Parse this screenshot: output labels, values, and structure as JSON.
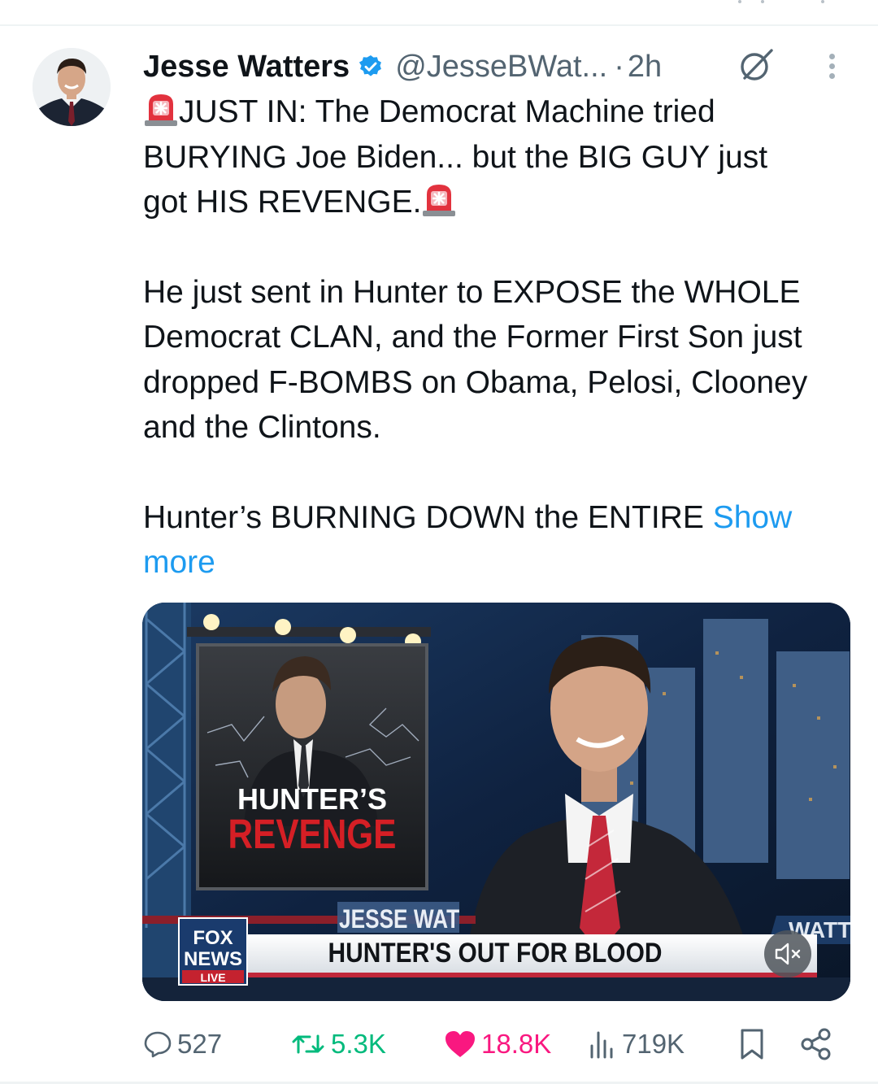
{
  "tweet": {
    "author": {
      "name": "Jesse Watters",
      "handle": "@JesseBWat...",
      "separator": "·",
      "time": "2h"
    },
    "text": {
      "line1": "JUST IN: The Democrat Machine tried",
      "line2": "BURYING Joe Biden... but the BIG GUY just",
      "line3": "got HIS REVENGE.",
      "paragraph2": "He just sent in Hunter to EXPOSE the WHOLE Democrat CLAN, and the Former First Son just dropped F-BOMBS on Obama, Pelosi, Clooney and the Clintons.",
      "paragraph3": "Hunter’s BURNING DOWN the ENTIRE ",
      "show_more": "Show more"
    },
    "media": {
      "board_title_1": "HUNTER’S",
      "board_title_2": "REVENGE",
      "lower_third_name": "JESSE WAT",
      "chyron": "HUNTER'S OUT FOR BLOOD",
      "logo_fox": "FOX",
      "logo_news": "NEWS",
      "logo_live": "LIVE",
      "side_text": "WATT"
    },
    "actions": {
      "replies": "527",
      "reposts": "5.3K",
      "likes": "18.8K",
      "views": "719K"
    },
    "colors": {
      "accent": "#1d9bf0",
      "like": "#f91880",
      "repost": "#00ba7c",
      "muted": "#536471",
      "verified": "#1d9bf0"
    },
    "icons": [
      "grok-icon",
      "more-icon",
      "siren-emoji",
      "reply-icon",
      "repost-icon",
      "heart-icon",
      "views-icon",
      "bookmark-icon",
      "share-icon",
      "mute-icon",
      "verified-badge-icon"
    ]
  }
}
